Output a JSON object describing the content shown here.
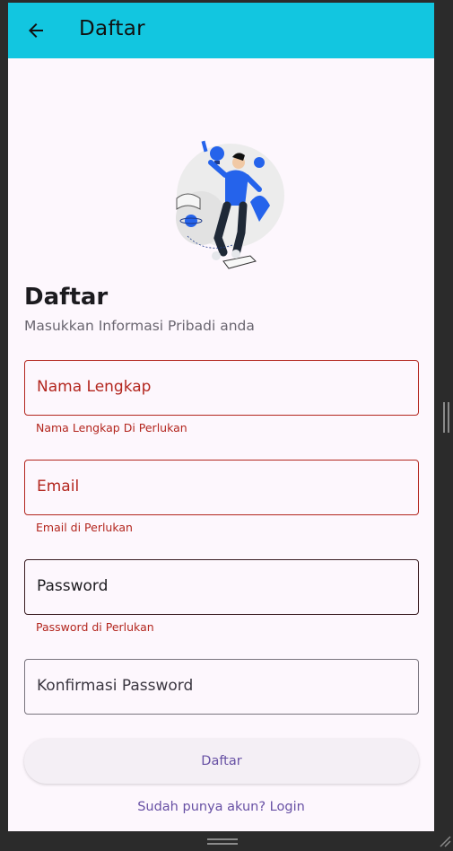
{
  "appbar": {
    "title": "Daftar",
    "color": "#12c6e0"
  },
  "header": {
    "title": "Daftar",
    "subtitle": "Masukkan Informasi Pribadi anda"
  },
  "illustration": {
    "icon": "person-with-ideas-illustration"
  },
  "form": {
    "fields": [
      {
        "label": "Nama Lengkap",
        "state": "error",
        "helper": "Nama Lengkap Di Perlukan"
      },
      {
        "label": "Email",
        "state": "error",
        "helper": "Email di Perlukan"
      },
      {
        "label": "Password",
        "state": "focused-error",
        "helper": "Password di Perlukan"
      },
      {
        "label": "Konfirmasi Password",
        "state": "normal",
        "helper": ""
      }
    ],
    "submit_label": "Daftar",
    "login_link": "Sudah punya akun? Login"
  },
  "colors": {
    "error": "#b3261e",
    "primary": "#6750a4",
    "background": "#fdf7fd"
  }
}
